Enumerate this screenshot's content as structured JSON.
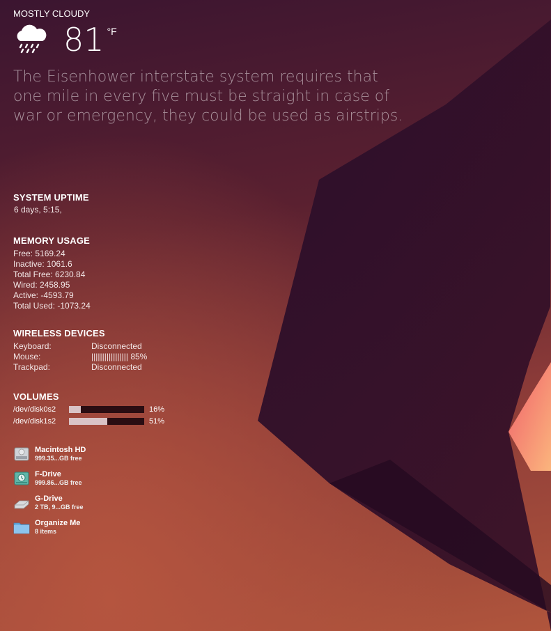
{
  "weather": {
    "condition": "MOSTLY CLOUDY",
    "temperature": "81",
    "unit": "°F",
    "icon": "rain-cloud-icon",
    "quote": "The Eisenhower interstate system requires that one mile in every five must be straight in case of war or emergency, they could be used as airstrips."
  },
  "uptime": {
    "title": "SYSTEM UPTIME",
    "value": "6 days, 5:15,"
  },
  "memory": {
    "title": "MEMORY USAGE",
    "rows": [
      "Free: 5169.24",
      "Inactive: 1061.6",
      "Total Free: 6230.84",
      "Wired: 2458.95",
      "Active: -4593.79",
      "Total Used: -1073.24"
    ]
  },
  "wireless": {
    "title": "WIRELESS DEVICES",
    "devices": [
      {
        "name": "Keyboard:",
        "status": "Disconnected"
      },
      {
        "name": "Mouse:",
        "status": "||||||||||||||||| 85%"
      },
      {
        "name": "Trackpad:",
        "status": "Disconnected"
      }
    ]
  },
  "volumes": {
    "title": "VOLUMES",
    "items": [
      {
        "name": "/dev/disk0s2",
        "percent_label": "16%",
        "used_fraction": 0.16
      },
      {
        "name": "/dev/disk1s2",
        "percent_label": "51%",
        "used_fraction": 0.51
      }
    ]
  },
  "drives": [
    {
      "name": "Macintosh HD",
      "sub": "999.35...GB free",
      "icon": "hard-drive-icon"
    },
    {
      "name": "F-Drive",
      "sub": "999.86...GB free",
      "icon": "time-machine-drive-icon"
    },
    {
      "name": "G-Drive",
      "sub": "2 TB, 9...GB free",
      "icon": "external-drive-icon"
    },
    {
      "name": "Organize Me",
      "sub": "8 items",
      "icon": "folder-icon"
    }
  ],
  "colors": {
    "background_top": "#3b1530",
    "background_bottom": "#b0553c",
    "shape_dark": "#2e1029",
    "accent_peach": "#f5906e",
    "bar_fill": "#d9c3c6",
    "bar_track": "#2a0d12"
  }
}
